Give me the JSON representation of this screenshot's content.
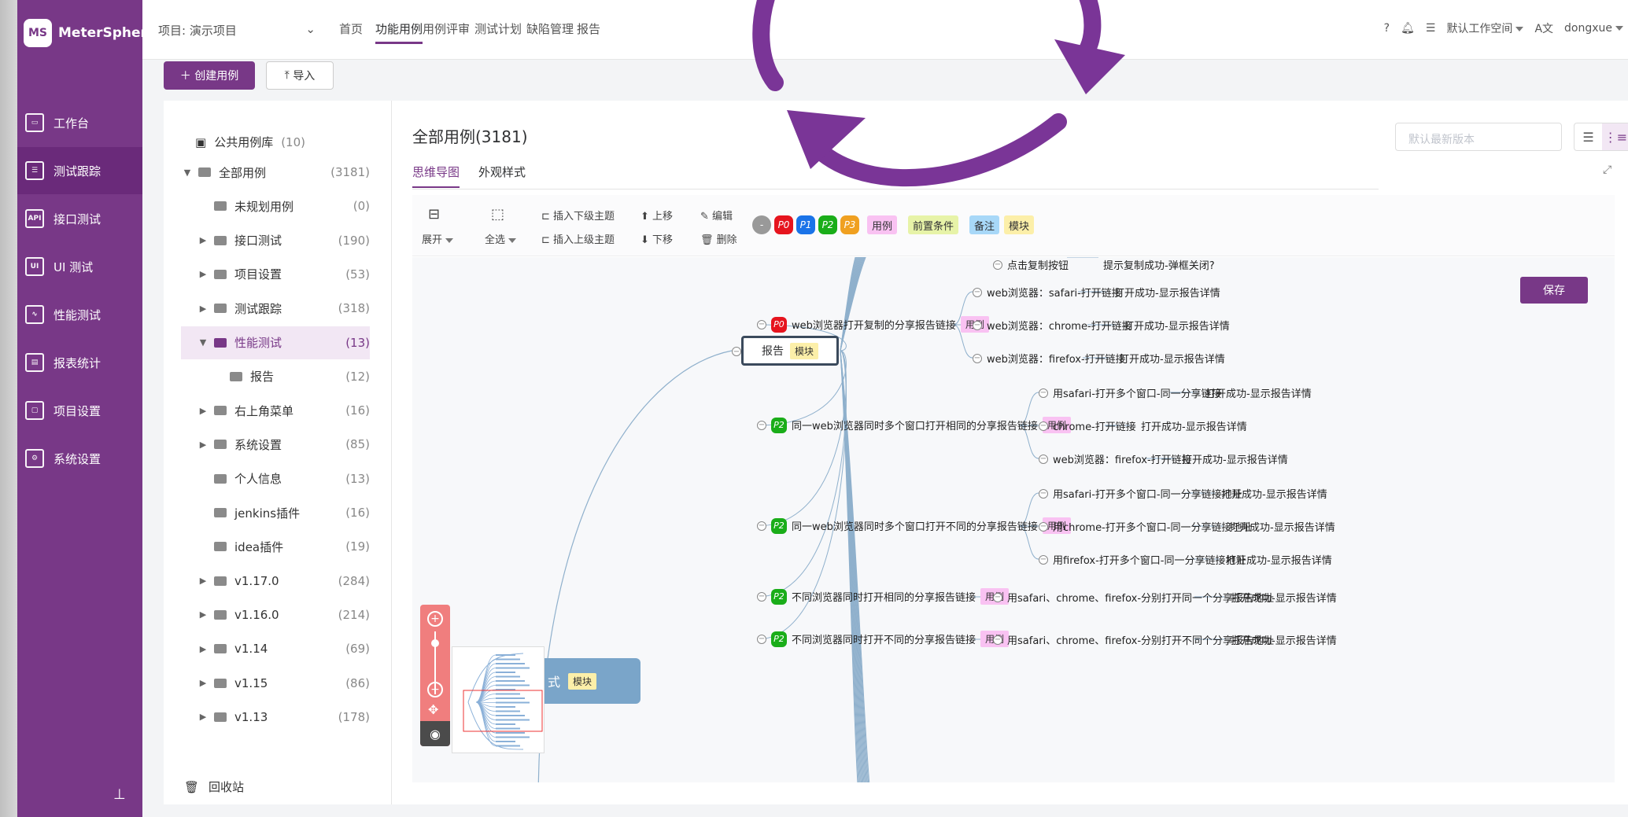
{
  "app": {
    "name": "MeterSphere",
    "logo_text": "MS"
  },
  "sidebar": {
    "items": [
      {
        "label": "工作台",
        "icon": "monitor-icon",
        "active": false
      },
      {
        "label": "测试跟踪",
        "icon": "clipboard-icon",
        "active": true
      },
      {
        "label": "接口测试",
        "icon": "api-icon",
        "active": false
      },
      {
        "label": "UI 测试",
        "icon": "ui-icon",
        "active": false
      },
      {
        "label": "性能测试",
        "icon": "performance-icon",
        "active": false
      },
      {
        "label": "报表统计",
        "icon": "report-icon",
        "active": false
      },
      {
        "label": "项目设置",
        "icon": "folder-settings-icon",
        "active": false
      },
      {
        "label": "系统设置",
        "icon": "gears-icon",
        "active": false
      }
    ],
    "pin_icon": "pin-icon"
  },
  "header": {
    "project": "项目: 演示项目",
    "nav": [
      "首页",
      "功能用例",
      "用例评审",
      "测试计划",
      "缺陷管理",
      "报告"
    ],
    "active_nav": "功能用例",
    "workspace": "默认工作空间",
    "user": "dongxue"
  },
  "actions": {
    "create": "创建用例",
    "import": "导入"
  },
  "tree": {
    "public_lib": {
      "label": "公共用例库",
      "count": "(10)"
    },
    "rows": [
      {
        "label": "全部用例",
        "count": "(3181)",
        "arrow": "▼",
        "indent": 0
      },
      {
        "label": "未规划用例",
        "count": "(0)",
        "arrow": "",
        "indent": 1
      },
      {
        "label": "接口测试",
        "count": "(190)",
        "arrow": "▶",
        "indent": 1
      },
      {
        "label": "项目设置",
        "count": "(53)",
        "arrow": "▶",
        "indent": 1
      },
      {
        "label": "测试跟踪",
        "count": "(318)",
        "arrow": "▶",
        "indent": 1
      },
      {
        "label": "性能测试",
        "count": "(13)",
        "arrow": "▼",
        "indent": 1,
        "active": true
      },
      {
        "label": "报告",
        "count": "(12)",
        "arrow": "",
        "indent": 2
      },
      {
        "label": "右上角菜单",
        "count": "(16)",
        "arrow": "▶",
        "indent": 1
      },
      {
        "label": "系统设置",
        "count": "(85)",
        "arrow": "▶",
        "indent": 1
      },
      {
        "label": "个人信息",
        "count": "(13)",
        "arrow": "",
        "indent": 1
      },
      {
        "label": "jenkins插件",
        "count": "(16)",
        "arrow": "",
        "indent": 1
      },
      {
        "label": "idea插件",
        "count": "(19)",
        "arrow": "",
        "indent": 1
      },
      {
        "label": "v1.17.0",
        "count": "(284)",
        "arrow": "▶",
        "indent": 1
      },
      {
        "label": "v1.16.0",
        "count": "(214)",
        "arrow": "▶",
        "indent": 1
      },
      {
        "label": "v1.14",
        "count": "(69)",
        "arrow": "▶",
        "indent": 1
      },
      {
        "label": "v1.15",
        "count": "(86)",
        "arrow": "▶",
        "indent": 1
      },
      {
        "label": "v1.13",
        "count": "(178)",
        "arrow": "▶",
        "indent": 1
      }
    ],
    "recycle": "回收站"
  },
  "main": {
    "title": "全部用例(3181)",
    "version_placeholder": "默认最新版本",
    "tabs": [
      "思维导图",
      "外观样式"
    ],
    "active_tab": "思维导图"
  },
  "toolbar": {
    "expand": "展开",
    "select_all": "全选",
    "insert_child": "插入下级主题",
    "insert_parent": "插入上级主题",
    "move_up": "上移",
    "move_down": "下移",
    "edit": "编辑",
    "delete": "删除",
    "priorities": [
      "P0",
      "P1",
      "P2",
      "P3"
    ],
    "tags": [
      "用例",
      "前置条件",
      "备注",
      "模块"
    ]
  },
  "mindmap": {
    "save": "保存",
    "root": {
      "label": "报告",
      "tag": "模块"
    },
    "minimap_tag": "模块",
    "minimap_char": "式",
    "top_partial": {
      "label": "点击复制按钮",
      "result": "提示复制成功-弹框关闭?"
    },
    "cases": [
      {
        "prio": "P0",
        "label": "web浏览器打开复制的分享报告链接",
        "tag": "用例",
        "steps": [
          {
            "step": "web浏览器：safari-打开链接",
            "result": "打开成功-显示报告详情"
          },
          {
            "step": "web浏览器：chrome-打开链接",
            "result": "打开成功-显示报告详情"
          },
          {
            "step": "web浏览器：firefox-打开链接",
            "result": "打开成功-显示报告详情"
          }
        ]
      },
      {
        "prio": "P2",
        "label": "同一web浏览器同时多个窗口打开相同的分享报告链接",
        "tag": "用例",
        "steps": [
          {
            "step": "用safari-打开多个窗口-同一分享链接",
            "result": "打开成功-显示报告详情"
          },
          {
            "step": "chrome-打开链接",
            "result": "打开成功-显示报告详情"
          },
          {
            "step": "web浏览器：firefox-打开链接",
            "result": "打开成功-显示报告详情"
          }
        ]
      },
      {
        "prio": "P2",
        "label": "同一web浏览器同时多个窗口打开不同的分享报告链接",
        "tag": "用例",
        "steps": [
          {
            "step": "用safari-打开多个窗口-同一分享链接地址",
            "result": "打开成功-显示报告详情"
          },
          {
            "step": "用chrome-打开多个窗口-同一分享链接地址",
            "result": "打开成功-显示报告详情"
          },
          {
            "step": "用firefox-打开多个窗口-同一分享链接地址",
            "result": "打开成功-显示报告详情"
          }
        ]
      },
      {
        "prio": "P2",
        "label": "不同浏览器同时打开相同的分享报告链接",
        "tag": "用例",
        "steps": [
          {
            "step": "用safari、chrome、firefox-分别打开同一个分享报告地址",
            "result": "打开成功-显示报告详情"
          }
        ]
      },
      {
        "prio": "P2",
        "label": "不同浏览器同时打开不同的分享报告链接",
        "tag": "用例",
        "steps": [
          {
            "step": "用safari、chrome、firefox-分别打开不同个分享报告地址",
            "result": "打开成功-显示报告详情"
          }
        ]
      }
    ]
  },
  "colors": {
    "brand": "#783887",
    "p0": "#e6141e",
    "p1": "#1a73e8",
    "p2": "#1aad19",
    "p3": "#f0a020"
  }
}
